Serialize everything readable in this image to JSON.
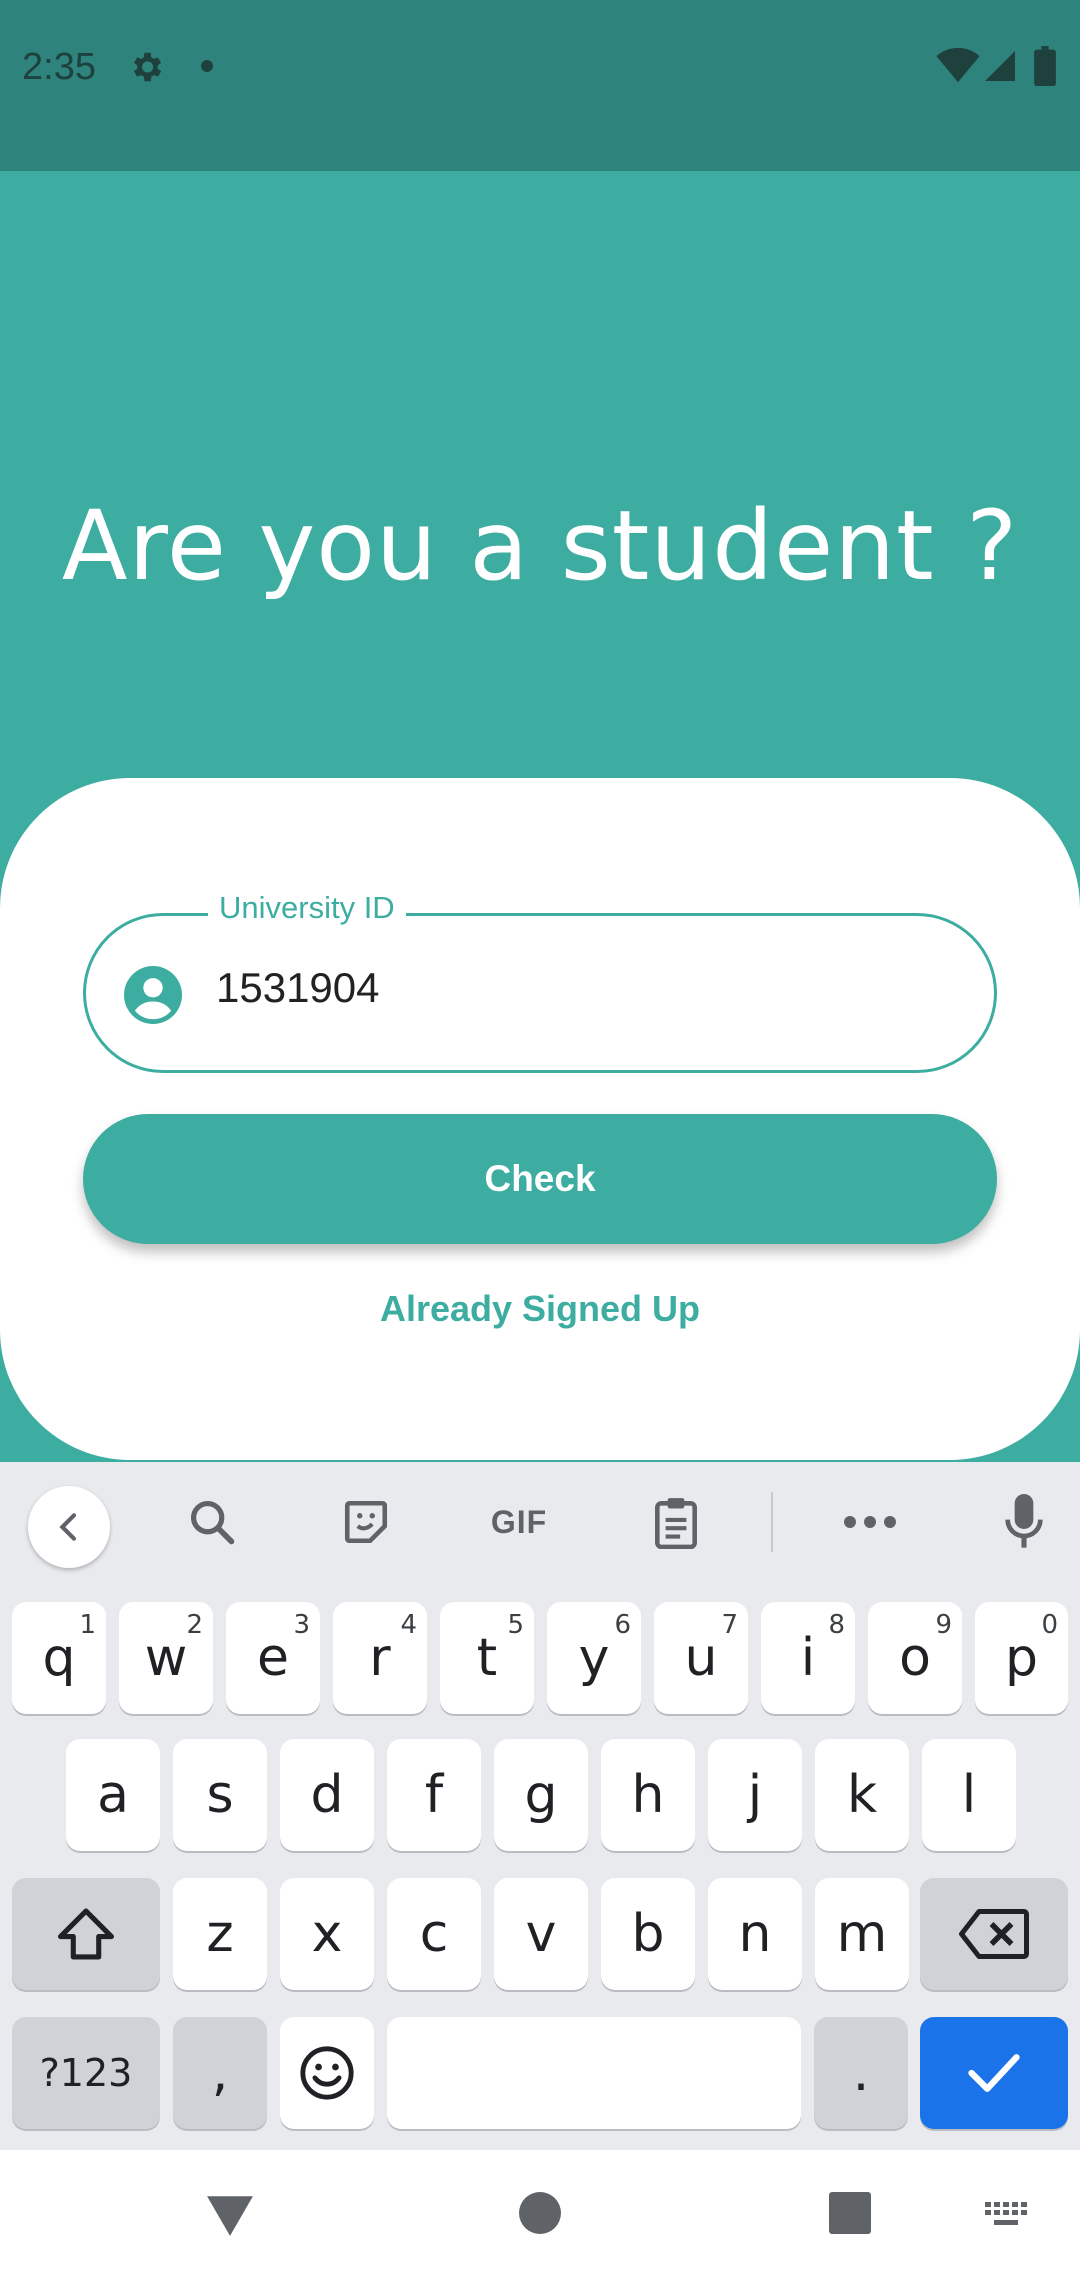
{
  "status_bar": {
    "time": "2:35"
  },
  "headline": "Are you a student ?",
  "form": {
    "field_label": "University ID",
    "field_value": "1531904",
    "check_label": "Check",
    "signed_up_label": "Already Signed Up"
  },
  "keyboard": {
    "toolbar": {
      "gif_label": "GIF"
    },
    "row1": [
      {
        "key": "q",
        "hint": "1"
      },
      {
        "key": "w",
        "hint": "2"
      },
      {
        "key": "e",
        "hint": "3"
      },
      {
        "key": "r",
        "hint": "4"
      },
      {
        "key": "t",
        "hint": "5"
      },
      {
        "key": "y",
        "hint": "6"
      },
      {
        "key": "u",
        "hint": "7"
      },
      {
        "key": "i",
        "hint": "8"
      },
      {
        "key": "o",
        "hint": "9"
      },
      {
        "key": "p",
        "hint": "0"
      }
    ],
    "row2": [
      "a",
      "s",
      "d",
      "f",
      "g",
      "h",
      "j",
      "k",
      "l"
    ],
    "row3": [
      "z",
      "x",
      "c",
      "v",
      "b",
      "n",
      "m"
    ],
    "symbols_label": "?123",
    "comma_label": ",",
    "period_label": ".",
    "accent_color": "#1a73e8"
  },
  "colors": {
    "brand": "#3eada1",
    "status_bar": "#2e847c"
  }
}
